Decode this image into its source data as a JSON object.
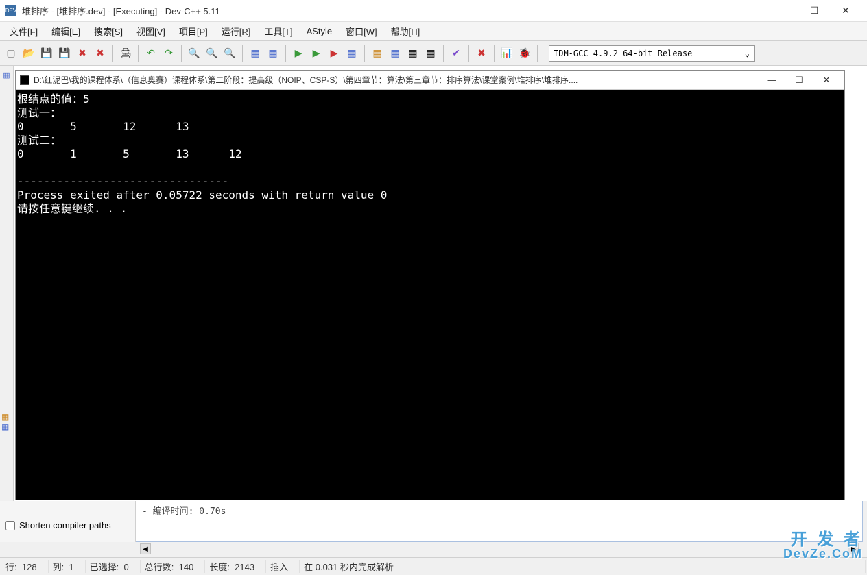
{
  "window": {
    "title": "堆排序 - [堆排序.dev] - [Executing] - Dev-C++ 5.11",
    "min": "—",
    "max": "☐",
    "close": "✕"
  },
  "menu": {
    "file": "文件[F]",
    "edit": "编辑[E]",
    "search": "搜索[S]",
    "view": "视图[V]",
    "project": "项目[P]",
    "run": "运行[R]",
    "tools": "工具[T]",
    "astyle": "AStyle",
    "window": "窗口[W]",
    "help": "帮助[H]"
  },
  "toolbar": {
    "compiler_select": "TDM-GCC 4.9.2 64-bit Release",
    "dropdown": "⌄"
  },
  "console": {
    "title": "D:\\红泥巴\\我的课程体系\\（信息奥赛）课程体系\\第二阶段：提高级（NOIP、CSP-S）\\第四章节：算法\\第三章节：排序算法\\课堂案例\\堆排序\\堆排序....",
    "min": "—",
    "max": "☐",
    "close": "✕",
    "line_root": "根结点的值：5",
    "line_test1": "测试一：",
    "row1_c0": "0",
    "row1_c1": "5",
    "row1_c2": "12",
    "row1_c3": "13",
    "line_test2": "测试二：",
    "row2_c0": "0",
    "row2_c1": "1",
    "row2_c2": "5",
    "row2_c3": "13",
    "row2_c4": "12",
    "blank": "",
    "sep": "--------------------------------",
    "exit": "Process exited after 0.05722 seconds with return value 0",
    "prompt": "请按任意键继续. . ."
  },
  "bottom": {
    "shorten_label": "Shorten compiler paths",
    "compile_time": "- 编译时间: 0.70s"
  },
  "status": {
    "line_label": "行:",
    "line_val": "128",
    "col_label": "列:",
    "col_val": "1",
    "sel_label": "已选择:",
    "sel_val": "0",
    "total_label": "总行数:",
    "total_val": "140",
    "len_label": "长度:",
    "len_val": "2143",
    "mode": "插入",
    "parse": "在 0.031 秒内完成解析"
  },
  "watermark": {
    "l1": "开 发 者",
    "l2": "DevZe.CoM"
  }
}
